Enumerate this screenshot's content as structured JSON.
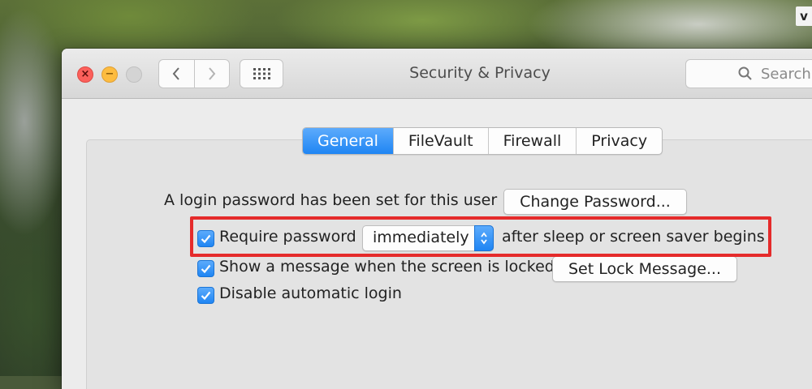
{
  "desktop": {
    "corner_text": "v"
  },
  "window": {
    "title": "Security & Privacy",
    "search": {
      "placeholder": "Search"
    }
  },
  "tabs": [
    {
      "label": "General",
      "active": true
    },
    {
      "label": "FileVault",
      "active": false
    },
    {
      "label": "Firewall",
      "active": false
    },
    {
      "label": "Privacy",
      "active": false
    }
  ],
  "general": {
    "login_password_text": "A login password has been set for this user",
    "change_password_button": "Change Password...",
    "require_password": {
      "checked": true,
      "label": "Require password",
      "select_value": "immediately",
      "suffix": "after sleep or screen saver begins"
    },
    "show_message": {
      "checked": true,
      "label": "Show a message when the screen is locked",
      "button": "Set Lock Message..."
    },
    "disable_auto_login": {
      "checked": true,
      "label": "Disable automatic login"
    }
  },
  "colors": {
    "accent": "#1f85f3",
    "highlight": "#e52b2b",
    "close": "#fc605b",
    "minimize": "#fdbc40"
  }
}
